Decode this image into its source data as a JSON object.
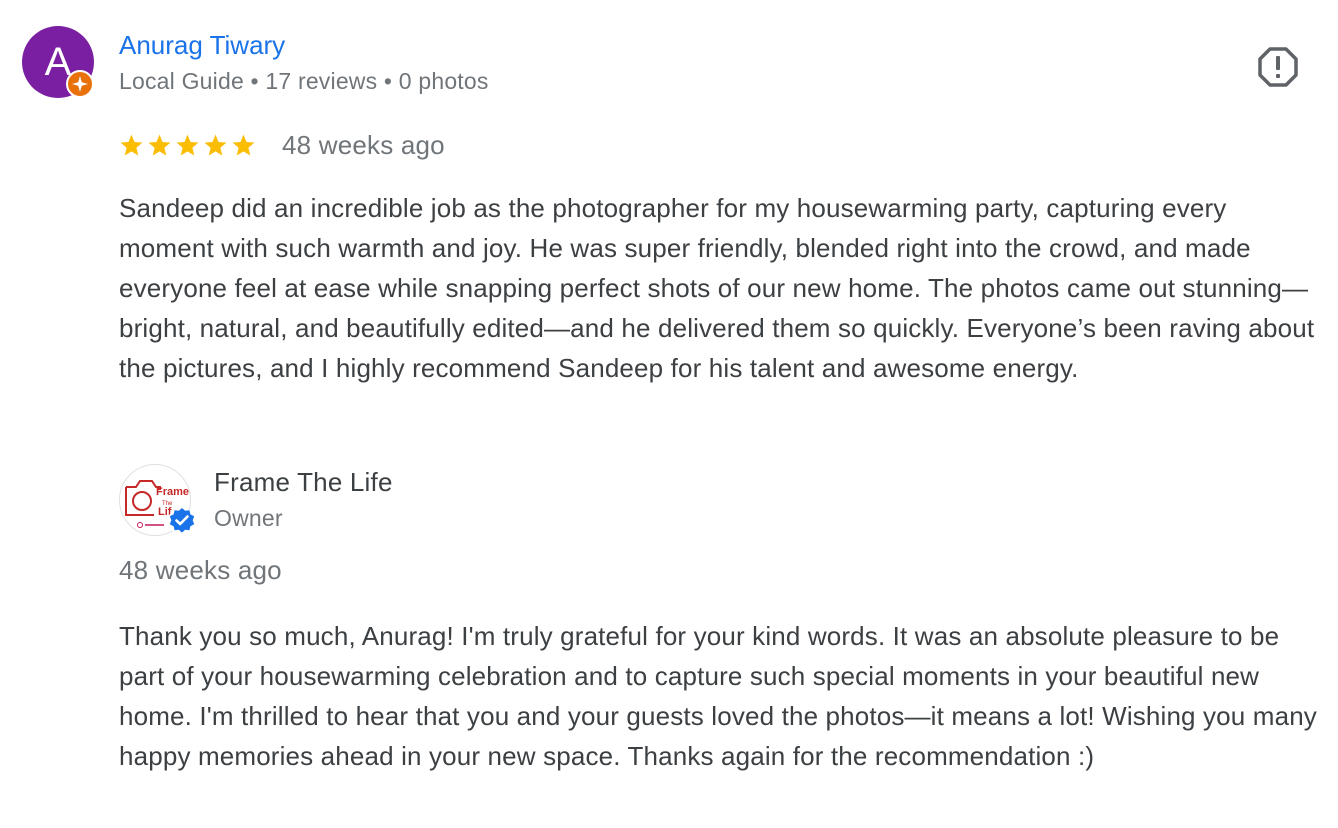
{
  "review": {
    "avatar_initial": "A",
    "avatar_color": "#7b1fa2",
    "badge_icon": "local-guide-star-icon",
    "reviewer_name": "Anurag Tiwary",
    "reviewer_meta": "Local Guide • 17 reviews • 0 photos",
    "rating": 5,
    "rating_max": 5,
    "date": "48 weeks ago",
    "text": "Sandeep did an incredible job as the photographer for my housewarming party, capturing every moment with such warmth and joy. He was super friendly, blended right into the crowd, and made everyone feel at ease while snapping perfect shots of our new home. The photos came out stunning—bright, natural, and beautifully edited—and he delivered them so quickly. Everyone’s been raving about the pictures, and I highly recommend Sandeep for his talent and awesome energy.",
    "report_icon": "report-icon"
  },
  "owner_response": {
    "logo_text": "Frame The Life",
    "logo_icon": "camera-logo-icon",
    "verified_icon": "verified-badge-icon",
    "name": "Frame The Life",
    "role": "Owner",
    "date": "48 weeks ago",
    "text": "Thank you so much, Anurag! I'm truly grateful for your kind words. It was an absolute pleasure to be part of your housewarming celebration and to capture such special moments in your beautiful new home. I'm thrilled to hear that you and your guests loved the photos—it means a lot! Wishing you many happy memories ahead in your new space. Thanks again for the recommendation :)"
  },
  "colors": {
    "link": "#1a73e8",
    "star": "#fbbc04",
    "muted": "#70757a",
    "text": "#3c4043",
    "local_guide_badge": "#e8710a",
    "verified": "#1a73e8"
  }
}
